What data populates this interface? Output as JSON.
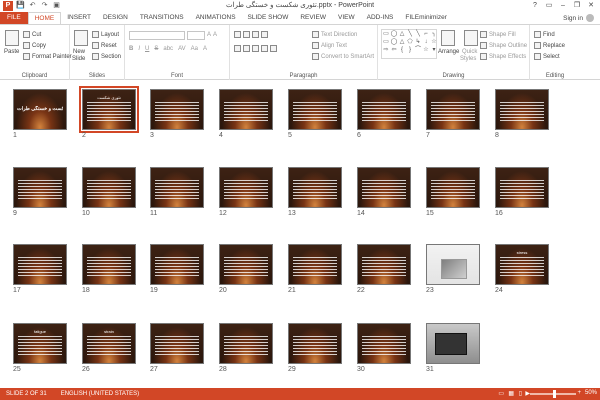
{
  "window": {
    "title": "تئوری شکست و خستگی طرات.pptx - PowerPoint",
    "app_icon": "P",
    "controls": [
      "?",
      "▭",
      "–",
      "❐",
      "✕"
    ]
  },
  "quick_access": {
    "save": "💾",
    "undo": "↶",
    "redo": "↷",
    "start": "▣"
  },
  "tabs": [
    "FILE",
    "HOME",
    "INSERT",
    "DESIGN",
    "TRANSITIONS",
    "ANIMATIONS",
    "SLIDE SHOW",
    "REVIEW",
    "VIEW",
    "ADD-INS",
    "FILEminimizer"
  ],
  "active_tab": "HOME",
  "signin": "Sign in",
  "ribbon": {
    "clipboard": {
      "paste": "Paste",
      "cut": "Cut",
      "copy": "Copy",
      "format_painter": "Format Painter",
      "label": "Clipboard"
    },
    "slides": {
      "new_slide": "New",
      "new_slide2": "Slide",
      "layout": "Layout",
      "reset": "Reset",
      "section": "Section",
      "label": "Slides"
    },
    "font": {
      "bold": "B",
      "italic": "I",
      "underline": "U",
      "strike": "S",
      "shadow": "abc",
      "spacing": "AV",
      "case": "Aa",
      "color": "A",
      "label": "Font"
    },
    "paragraph": {
      "text_direction": "Text Direction",
      "align_text": "Align Text",
      "smartart": "Convert to SmartArt",
      "label": "Paragraph"
    },
    "drawing": {
      "arrange": "Arrange",
      "quick_styles": "Quick",
      "quick_styles2": "Styles",
      "shape_fill": "Shape Fill",
      "shape_outline": "Shape Outline",
      "shape_effects": "Shape Effects",
      "label": "Drawing"
    },
    "editing": {
      "find": "Find",
      "replace": "Replace",
      "select": "Select",
      "label": "Editing"
    }
  },
  "slides": [
    {
      "n": "1",
      "title": "تئوری شکست و خستگی طرات",
      "kind": "titleslide"
    },
    {
      "n": "2",
      "title": "تئوری شکست",
      "kind": "text"
    },
    {
      "n": "3",
      "title": "",
      "kind": "text"
    },
    {
      "n": "4",
      "title": "",
      "kind": "text"
    },
    {
      "n": "5",
      "title": "",
      "kind": "text"
    },
    {
      "n": "6",
      "title": "",
      "kind": "text"
    },
    {
      "n": "7",
      "title": "",
      "kind": "text"
    },
    {
      "n": "8",
      "title": "",
      "kind": "text"
    },
    {
      "n": "9",
      "title": "",
      "kind": "text"
    },
    {
      "n": "10",
      "title": "",
      "kind": "text"
    },
    {
      "n": "11",
      "title": "",
      "kind": "text"
    },
    {
      "n": "12",
      "title": "",
      "kind": "text"
    },
    {
      "n": "13",
      "title": "",
      "kind": "text"
    },
    {
      "n": "14",
      "title": "",
      "kind": "text"
    },
    {
      "n": "15",
      "title": "",
      "kind": "text"
    },
    {
      "n": "16",
      "title": "",
      "kind": "text"
    },
    {
      "n": "17",
      "title": "",
      "kind": "text"
    },
    {
      "n": "18",
      "title": "",
      "kind": "text"
    },
    {
      "n": "19",
      "title": "",
      "kind": "text"
    },
    {
      "n": "20",
      "title": "",
      "kind": "text"
    },
    {
      "n": "21",
      "title": "",
      "kind": "text"
    },
    {
      "n": "22",
      "title": "",
      "kind": "text"
    },
    {
      "n": "23",
      "title": "",
      "kind": "chart"
    },
    {
      "n": "24",
      "title": "stress",
      "kind": "text"
    },
    {
      "n": "25",
      "title": "fatigue",
      "kind": "text"
    },
    {
      "n": "26",
      "title": "strain",
      "kind": "text"
    },
    {
      "n": "27",
      "title": "",
      "kind": "text"
    },
    {
      "n": "28",
      "title": "",
      "kind": "text"
    },
    {
      "n": "29",
      "title": "",
      "kind": "text"
    },
    {
      "n": "30",
      "title": "",
      "kind": "text"
    },
    {
      "n": "31",
      "title": "",
      "kind": "photo"
    }
  ],
  "selected_slide": "2",
  "status": {
    "slide_info": "SLIDE 2 OF 31",
    "language": "ENGLISH (UNITED STATES)",
    "zoom": "50%",
    "zoom_minus": "–",
    "zoom_plus": "+",
    "normal_view_icon": "▭",
    "sorter_view_icon": "▦",
    "reading_view_icon": "▯",
    "slideshow_icon": "▶"
  }
}
